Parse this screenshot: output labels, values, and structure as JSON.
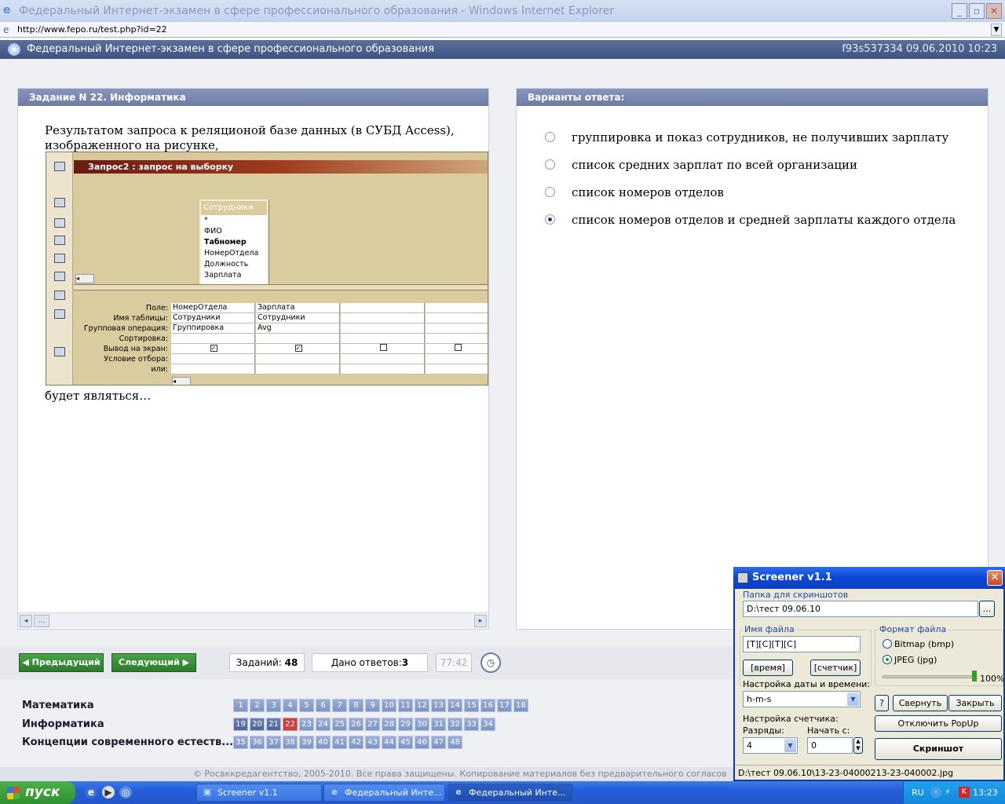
{
  "browser": {
    "title": "Федеральный Интернет-экзамен в сфере профессионального образования - Windows Internet Explorer",
    "url": "http://www.fepo.ru/test.php?id=22"
  },
  "site": {
    "header": "Федеральный Интернет-экзамен в сфере профессионального образования",
    "session": "f93s537334 09.06.2010 10:23"
  },
  "question": {
    "heading": "Задание N 22. Информатика",
    "text_line1": "Результатом запроса к реляционой базе данных (в СУБД Access),",
    "text_line2": "изображенного на рисунке,",
    "text_after": "будет являться…"
  },
  "access": {
    "window_title": "Запрос2 : запрос на выборку",
    "table_name": "Сотрудники",
    "fields": [
      "*",
      "ФИО",
      "Табномер",
      "НомерОтдела",
      "Должность",
      "Зарплата"
    ],
    "row_labels": [
      "Поле:",
      "Имя таблицы:",
      "Групповая операция:",
      "Сортировка:",
      "Вывод на экран:",
      "Условие отбора:",
      "или:"
    ],
    "col1": {
      "field": "НомерОтдела",
      "table": "Сотрудники",
      "group": "Группировка"
    },
    "col2": {
      "field": "Зарплата",
      "table": "Сотрудники",
      "group": "Avg"
    }
  },
  "answers": {
    "heading": "Варианты ответа:",
    "options": [
      {
        "label": "группировка и показ сотрудников, не получивших зарплату",
        "selected": false
      },
      {
        "label": "список средних зарплат по всей организации",
        "selected": false
      },
      {
        "label": "список номеров отделов",
        "selected": false
      },
      {
        "label": "список номеров отделов и средней зарплаты каждого отдела",
        "selected": true
      }
    ]
  },
  "nav": {
    "prev": "Предыдущий",
    "next": "Следующий",
    "tasks_label": "Заданий:",
    "tasks_count": "48",
    "answered_label": "Дано ответов:",
    "answered_count": "3",
    "timer": "77:42"
  },
  "subjects": [
    {
      "name": "Математика",
      "start": 1,
      "end": 18
    },
    {
      "name": "Информатика",
      "start": 19,
      "end": 34
    },
    {
      "name": "Концепции современного естеств...",
      "start": 35,
      "end": 48
    }
  ],
  "current_question": 22,
  "footer": "© Росаккредагентство, 2005-2010. Все права защищены. Копирование материалов без предварительного согласов",
  "screener": {
    "title": "Screener v1.1",
    "folder_label": "Папка для скриншотов",
    "folder_value": "D:\\тест 09.06.10",
    "browse": "...",
    "filename_label": "Имя файла",
    "filename_value": "[Т][С][Т][С]",
    "time_btn": "[время]",
    "counter_btn": "[счетчик]",
    "datetime_label": "Настройка даты и времени:",
    "datetime_value": "h-m-s",
    "counter_label": "Настройка счетчика:",
    "digits_label": "Разряды:",
    "digits_value": "4",
    "start_label": "Начать с:",
    "start_value": "0",
    "format_label": "Формат файла",
    "format_bmp": "Bitmap (bmp)",
    "format_jpg": "JPEG (jpg)",
    "quality": "100%",
    "help": "?",
    "minimize": "Свернуть",
    "close": "Закрыть",
    "popup": "Отключить PopUp",
    "shot": "Скриншот",
    "status": "D:\\тест 09.06.10\\13-23-04000213-23-040002.jpg"
  },
  "taskbar": {
    "start": "пуск",
    "tasks": [
      "Screener v1.1",
      "Федеральный Инте...",
      "Федеральный Инте..."
    ],
    "lang": "RU",
    "time": "13:23"
  }
}
